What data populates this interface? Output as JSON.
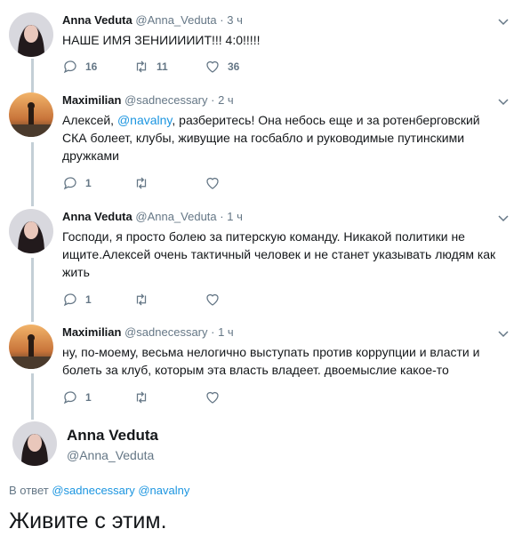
{
  "tweets": [
    {
      "name": "Anna Veduta",
      "handle": "@Anna_Veduta",
      "time": "3 ч",
      "text": "НАШЕ ИМЯ ЗЕНИИИИИТ!!! 4:0!!!!!",
      "replies": "16",
      "retweets": "11",
      "likes": "36"
    },
    {
      "name": "Maximilian",
      "handle": "@sadnecessary",
      "time": "2 ч",
      "text_before": "Алексей, ",
      "mention": "@navalny",
      "text_after": ", разберитесь! Она небось еще и за ротенберговский СКА болеет, клубы, живущие на госбабло и руководимые путинскими дружками",
      "replies": "1",
      "retweets": "",
      "likes": ""
    },
    {
      "name": "Anna Veduta",
      "handle": "@Anna_Veduta",
      "time": "1 ч",
      "text": "Господи, я просто болею за питерскую команду. Никакой политики не ищите.Алексей очень тактичный человек и не станет указывать людям как жить",
      "replies": "1",
      "retweets": "",
      "likes": ""
    },
    {
      "name": "Maximilian",
      "handle": "@sadnecessary",
      "time": "1 ч",
      "text": "ну, по-моему, весьма нелогично выступать против коррупции и власти и болеть за клуб, которым эта власть владеет. двоемыслие какое-то",
      "replies": "1",
      "retweets": "",
      "likes": ""
    }
  ],
  "main_tweet": {
    "name": "Anna Veduta",
    "handle": "@Anna_Veduta",
    "reply_prefix": "В ответ",
    "reply_mentions": [
      "@sadnecessary",
      "@navalny"
    ],
    "text": "Живите с этим."
  },
  "separator": "·",
  "icons": {
    "reply": "reply-icon",
    "retweet": "retweet-icon",
    "like": "heart-icon",
    "more": "chevron-down-icon"
  },
  "colors": {
    "text": "#14171a",
    "secondary": "#657786",
    "link": "#1b95e0",
    "thread_line": "#c4cfd6"
  }
}
